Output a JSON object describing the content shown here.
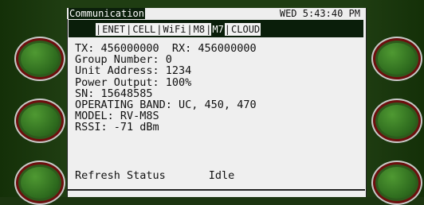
{
  "header": {
    "title": "Communication",
    "datetime": "WED 5:43:40 PM"
  },
  "tabs": [
    {
      "label": "ENET",
      "active": false
    },
    {
      "label": "CELL",
      "active": false
    },
    {
      "label": "WiFi",
      "active": false
    },
    {
      "label": "M8",
      "active": false
    },
    {
      "label": "M7",
      "active": true
    },
    {
      "label": "CLOUD",
      "active": false
    }
  ],
  "info": {
    "tx_rx": "TX: 456000000  RX: 456000000",
    "group": "Group Number: 0",
    "unit": "Unit Address: 1234",
    "power": "Power Output: 100%",
    "sn": "SN: 15648585",
    "band": "OPERATING BAND: UC, 450, 470",
    "model": "MODEL: RV-M8S",
    "rssi": "RSSI: -71 dBm"
  },
  "status": {
    "action": "Refresh Status",
    "state": "Idle"
  }
}
